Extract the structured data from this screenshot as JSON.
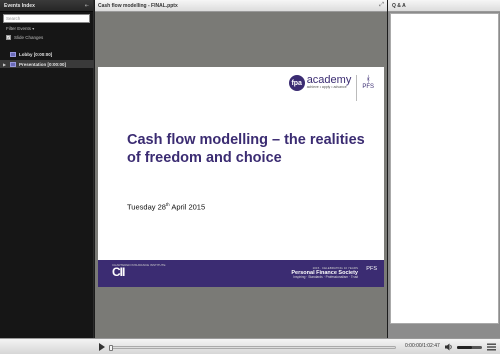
{
  "events": {
    "title": "Events Index",
    "collapse_icon": "collapse-left-icon",
    "search_placeholder": "Search",
    "filter_label": "Filter Events",
    "filter_arrow": "▾",
    "slide_changes_label": "Slide Changes",
    "slide_changes_checked": true,
    "items": [
      {
        "label": "Lobby [0:00:00]",
        "expanded": false,
        "selected": false
      },
      {
        "label": "Presentation [0:00:00]",
        "expanded": true,
        "selected": true
      }
    ]
  },
  "slide_panel": {
    "title": "Cash flow modelling - FINAL.pptx",
    "expand_icon": "fullscreen-icon"
  },
  "slide": {
    "logo_fpa": "fpa",
    "logo_academy": "academy",
    "logo_tagline": "achieve • apply • advance",
    "logo_pfs": "PFS",
    "title": "Cash flow modelling – the realities of freedom and choice",
    "date_prefix": "Tuesday 28",
    "date_sup": "th",
    "date_suffix": " April 2015",
    "footer_left": "CII",
    "footer_left_small": "CHARTERED INSURANCE INSTITUTE",
    "footer_right_top": "Personal Finance Society",
    "footer_right_sub": "Inspiring · Standards · Professionalism · Trust",
    "footer_right_small": "2015 · CELEBRATING 10 YEARS",
    "footer_pfs": "PFS"
  },
  "qa": {
    "title": "Q & A"
  },
  "controls": {
    "time": "0:00:00/1:02:47",
    "progress": 0.0,
    "volume": 0.6,
    "accent": "#3b2c72"
  }
}
